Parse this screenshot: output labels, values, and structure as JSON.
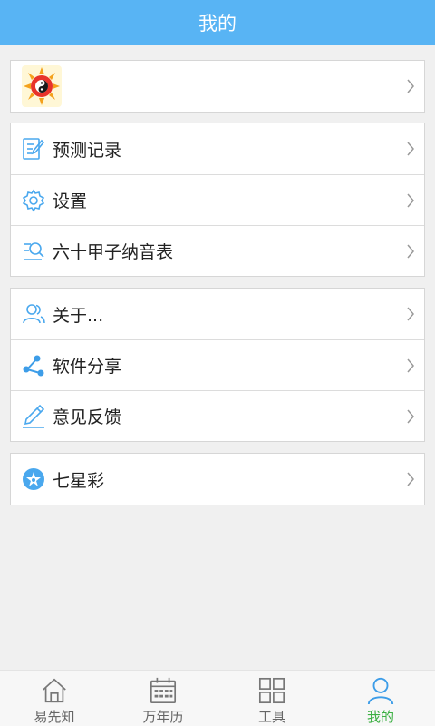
{
  "header": {
    "title": "我的"
  },
  "profile": {
    "avatar_icon": "yin-yang-sun-icon"
  },
  "group1": [
    {
      "label": "预测记录",
      "icon": "record-edit-icon"
    },
    {
      "label": "设置",
      "icon": "gear-icon"
    },
    {
      "label": "六十甲子纳音表",
      "icon": "search-list-icon"
    }
  ],
  "group2": [
    {
      "label": "关于...",
      "icon": "users-icon"
    },
    {
      "label": "软件分享",
      "icon": "share-icon"
    },
    {
      "label": "意见反馈",
      "icon": "pen-icon"
    }
  ],
  "group3": [
    {
      "label": "七星彩",
      "icon": "star-badge-icon"
    }
  ],
  "tabs": [
    {
      "label": "易先知",
      "icon": "home-icon"
    },
    {
      "label": "万年历",
      "icon": "calendar-icon"
    },
    {
      "label": "工具",
      "icon": "grid-icon"
    },
    {
      "label": "我的",
      "icon": "person-icon",
      "active": true
    }
  ],
  "colors": {
    "accent": "#58b4f4",
    "active_tab": "#3cb043"
  }
}
